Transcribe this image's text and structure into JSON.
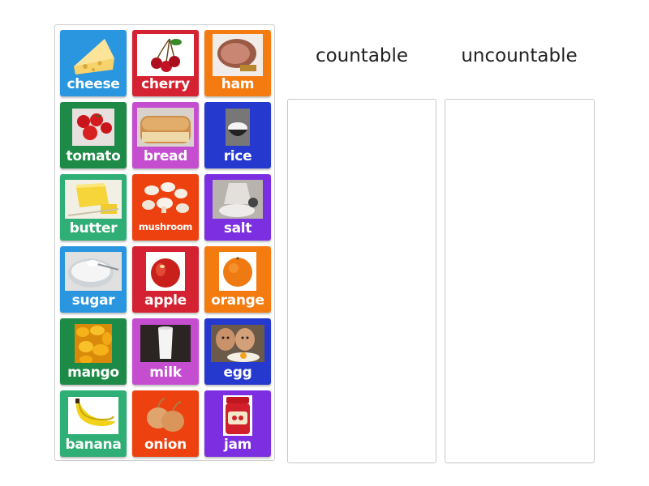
{
  "columns": [
    {
      "title": "countable"
    },
    {
      "title": "uncountable"
    }
  ],
  "cards": [
    {
      "label": "cheese",
      "color": "#2a96e0",
      "icon": "cheese-icon"
    },
    {
      "label": "cherry",
      "color": "#d42232",
      "icon": "cherry-icon"
    },
    {
      "label": "ham",
      "color": "#f47b0f",
      "icon": "ham-icon"
    },
    {
      "label": "tomato",
      "color": "#1e8a47",
      "icon": "tomato-icon"
    },
    {
      "label": "bread",
      "color": "#c54ed0",
      "icon": "bread-icon"
    },
    {
      "label": "rice",
      "color": "#2639cf",
      "icon": "rice-icon"
    },
    {
      "label": "butter",
      "color": "#2fae75",
      "icon": "butter-icon"
    },
    {
      "label": "mushroom",
      "color": "#ee4110",
      "icon": "mushroom-icon"
    },
    {
      "label": "salt",
      "color": "#7b2fe0",
      "icon": "salt-icon"
    },
    {
      "label": "sugar",
      "color": "#2a96e0",
      "icon": "sugar-icon"
    },
    {
      "label": "apple",
      "color": "#d42232",
      "icon": "apple-icon"
    },
    {
      "label": "orange",
      "color": "#f47b0f",
      "icon": "orange-icon"
    },
    {
      "label": "mango",
      "color": "#1e8a47",
      "icon": "mango-icon"
    },
    {
      "label": "milk",
      "color": "#c54ed0",
      "icon": "milk-icon"
    },
    {
      "label": "egg",
      "color": "#2639cf",
      "icon": "egg-icon"
    },
    {
      "label": "banana",
      "color": "#2fae75",
      "icon": "banana-icon"
    },
    {
      "label": "onion",
      "color": "#ee4110",
      "icon": "onion-icon"
    },
    {
      "label": "jam",
      "color": "#7b2fe0",
      "icon": "jam-icon"
    }
  ]
}
